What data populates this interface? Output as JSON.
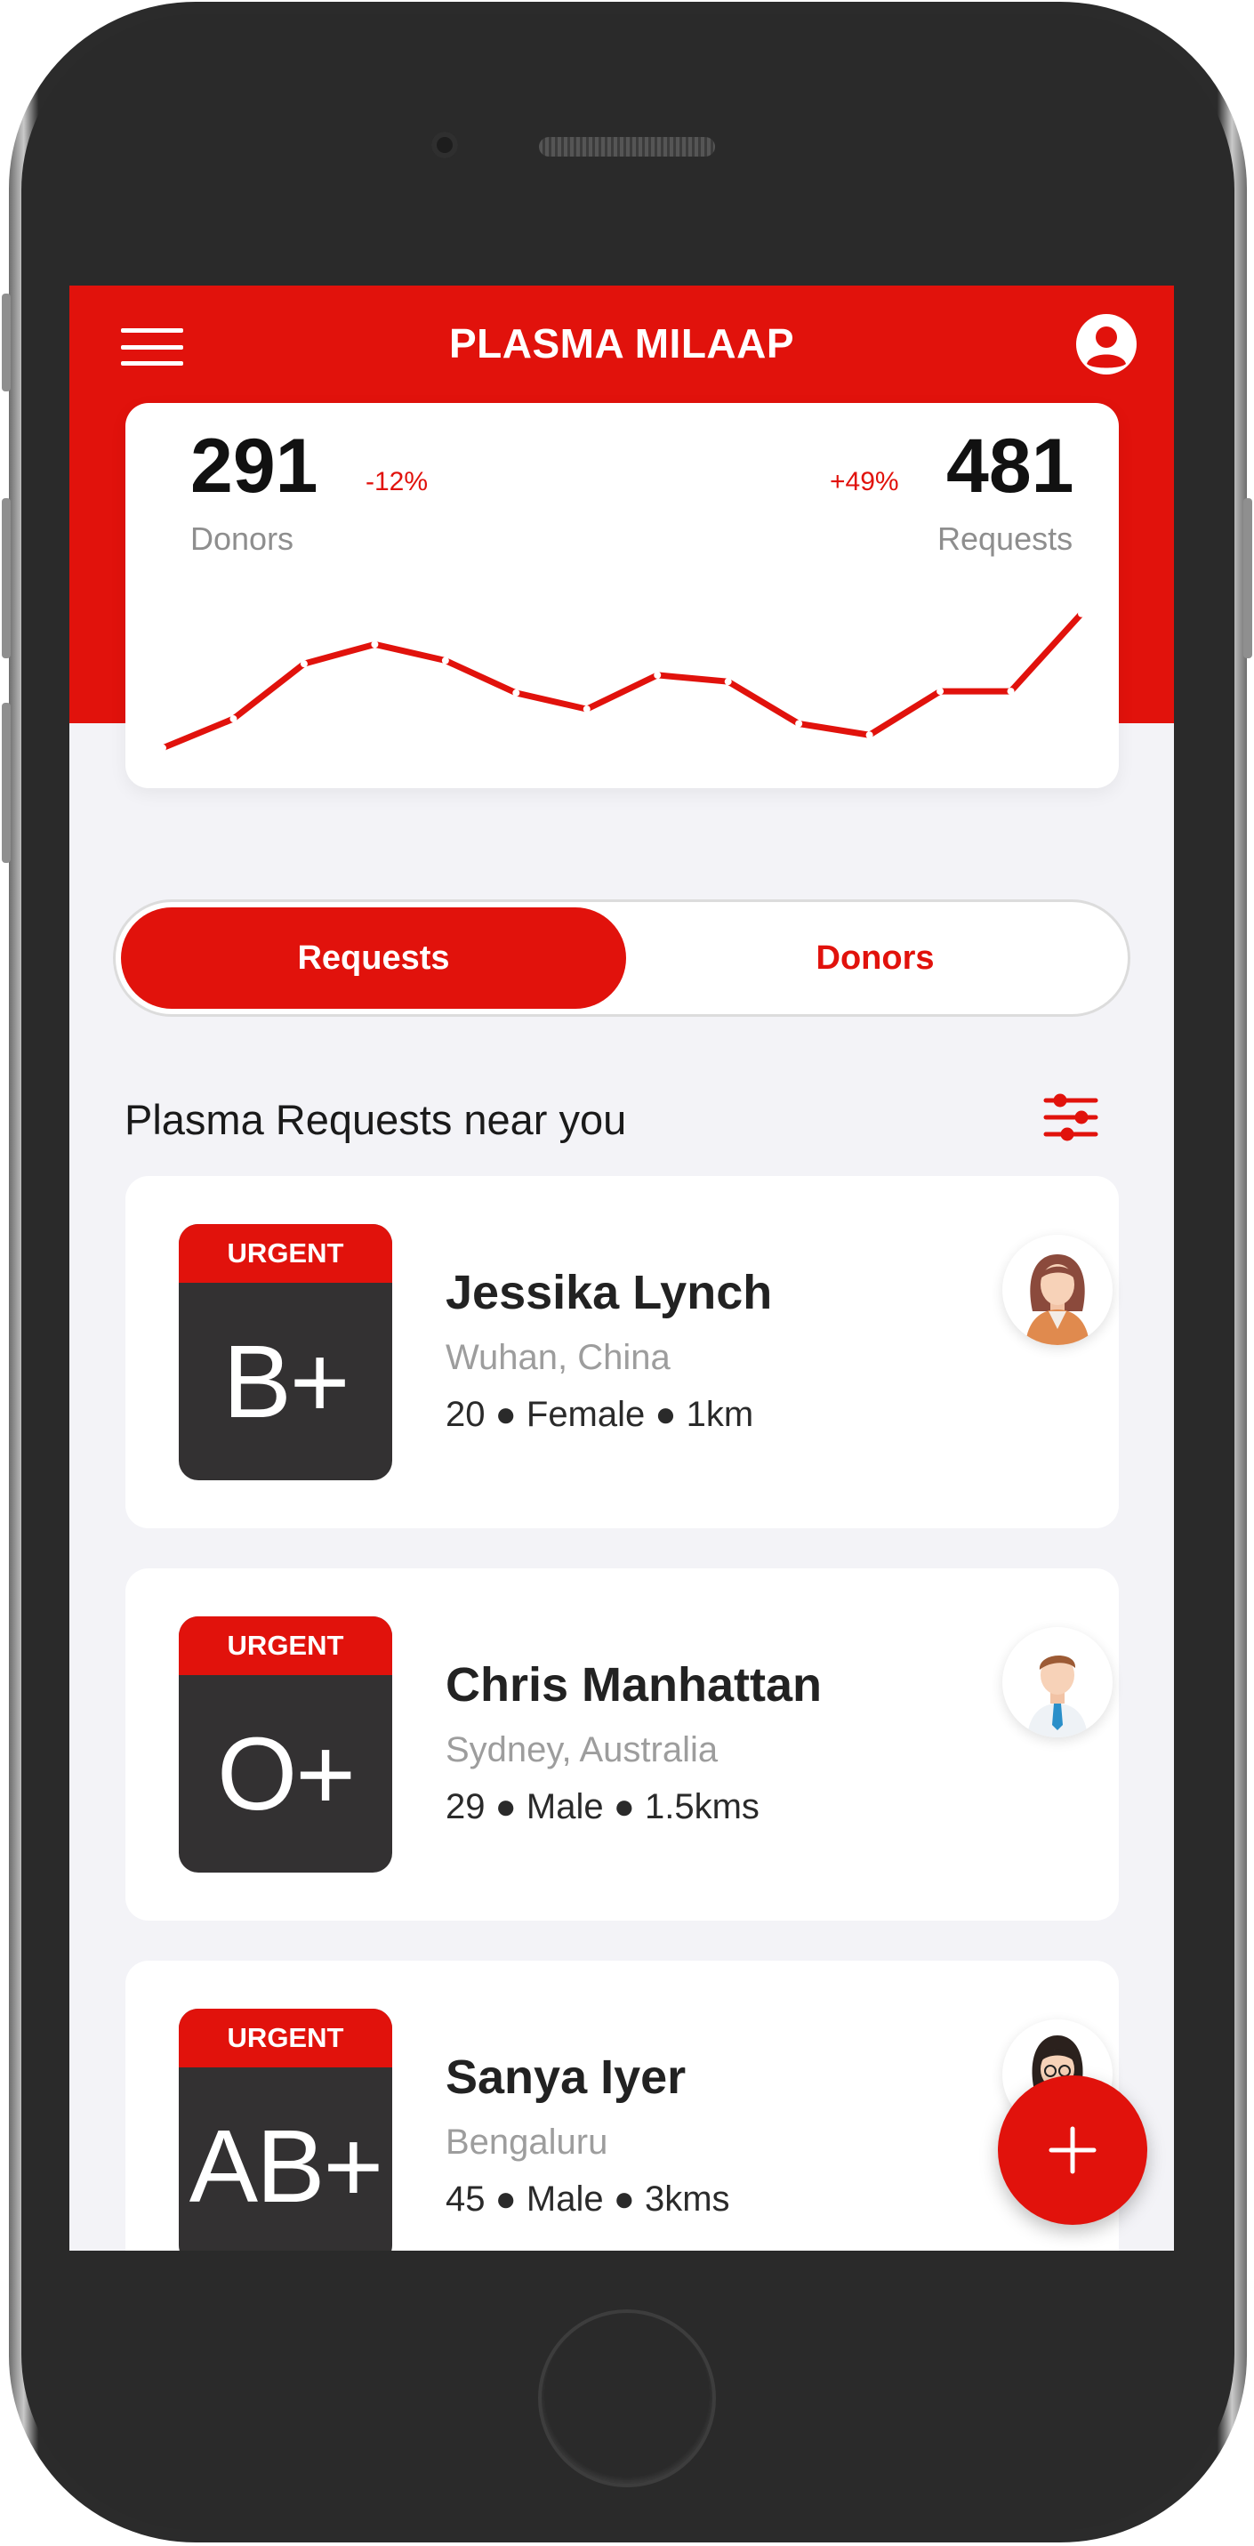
{
  "header": {
    "title": "PLASMA MILAAP",
    "menu_icon": "hamburger-menu-icon",
    "profile_icon": "user-circle-icon",
    "accent_color": "#e1120c"
  },
  "stats": {
    "donors": {
      "value": "291",
      "label": "Donors",
      "change": "-12%"
    },
    "requests": {
      "value": "481",
      "label": "Requests",
      "change": "+49%"
    }
  },
  "chart_data": {
    "type": "line",
    "title": "",
    "xlabel": "",
    "ylabel": "",
    "grid": false,
    "axes_visible": false,
    "series": [
      {
        "values": [
          10,
          28,
          62,
          74,
          64,
          44,
          34,
          55,
          51,
          25,
          18,
          45,
          45,
          93
        ],
        "color": "#e1120c"
      }
    ],
    "ylim": [
      0,
      100
    ]
  },
  "toggle": {
    "options": [
      "Requests",
      "Donors"
    ],
    "selected": "Requests"
  },
  "section": {
    "title": "Plasma Requests near you",
    "filter_icon": "sliders-filter-icon"
  },
  "requests": [
    {
      "badge": "URGENT",
      "blood_type": "B+",
      "name": "Jessika Lynch",
      "location": "Wuhan, China",
      "meta": "20 ● Female ● 1km",
      "avatar": "woman-avatar-icon"
    },
    {
      "badge": "URGENT",
      "blood_type": "O+",
      "name": "Chris Manhattan",
      "location": "Sydney, Australia",
      "meta": "29 ● Male ● 1.5kms",
      "avatar": "man-avatar-icon"
    },
    {
      "badge": "URGENT",
      "blood_type": "AB+",
      "name": "Sanya Iyer",
      "location": "Bengaluru",
      "meta": "45 ● Male ● 3kms",
      "avatar": "woman-glasses-avatar-icon"
    }
  ],
  "fab": {
    "icon": "plus-icon"
  }
}
